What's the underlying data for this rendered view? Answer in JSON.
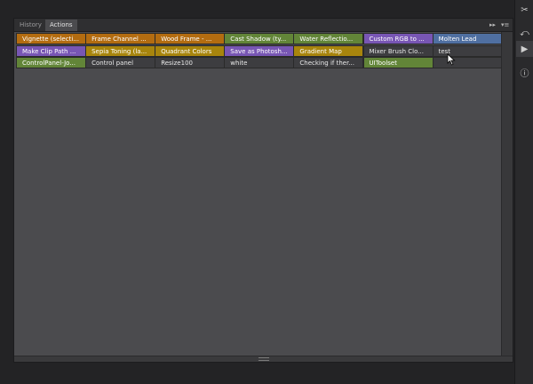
{
  "tabs": {
    "history": "History",
    "actions": "Actions"
  },
  "tab_controls": {
    "collapse": "▸▸",
    "menu": "▾≡"
  },
  "actions": [
    [
      {
        "label": "Vignette (selecti...",
        "color": "orange"
      },
      {
        "label": "Frame Channel ...",
        "color": "orange"
      },
      {
        "label": "Wood Frame - ...",
        "color": "orange"
      },
      {
        "label": "Cast Shadow (ty...",
        "color": "green"
      },
      {
        "label": "Water Reflectio...",
        "color": "green"
      },
      {
        "label": "Custom RGB to ...",
        "color": "purple"
      },
      {
        "label": "Molten Lead",
        "color": "blue"
      }
    ],
    [
      {
        "label": "Make Clip Path ...",
        "color": "purple"
      },
      {
        "label": "Sepia Toning (la...",
        "color": "yellow"
      },
      {
        "label": "Quadrant Colors",
        "color": "yellow"
      },
      {
        "label": "Save as Photosh...",
        "color": "purple"
      },
      {
        "label": "Gradient Map",
        "color": "yellow"
      },
      {
        "label": "Mixer Brush Clo...",
        "color": "none"
      },
      {
        "label": "test",
        "color": "none"
      }
    ],
    [
      {
        "label": "ControlPanel-Jo...",
        "color": "green"
      },
      {
        "label": "Control panel",
        "color": "none"
      },
      {
        "label": "Resize100",
        "color": "none"
      },
      {
        "label": "white",
        "color": "none"
      },
      {
        "label": "Checking if ther...",
        "color": "none"
      },
      {
        "label": "UIToolset",
        "color": "green"
      },
      {
        "label": "",
        "color": "none"
      }
    ]
  ],
  "dock": [
    {
      "name": "tools-icon",
      "glyph": "✂"
    },
    {
      "name": "history-brush-icon",
      "glyph": "⤺"
    },
    {
      "name": "play-actions-icon",
      "glyph": "▶"
    },
    {
      "name": "info-icon",
      "glyph": "ⓘ"
    }
  ]
}
